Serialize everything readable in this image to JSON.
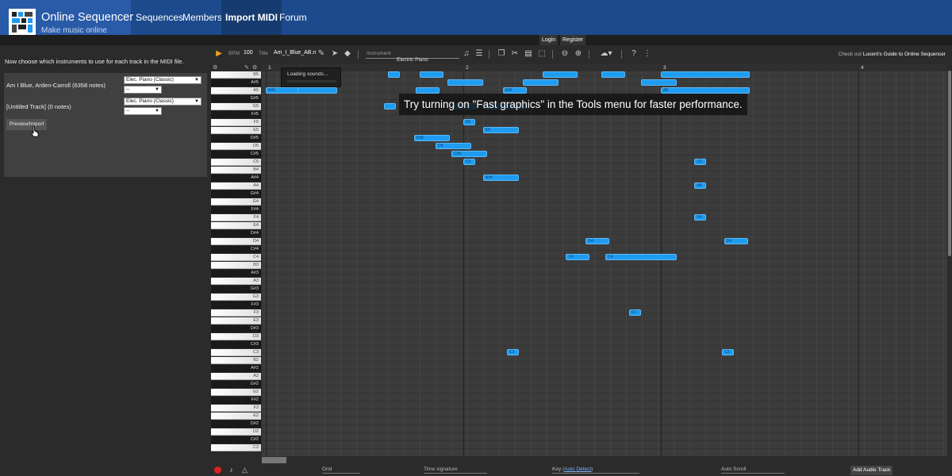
{
  "brand": {
    "title": "Online Sequencer",
    "subtitle": "Make music online"
  },
  "nav": {
    "items": [
      "Sequences",
      "Members",
      "Import MIDI",
      "Forum"
    ],
    "active": "Import MIDI"
  },
  "auth": {
    "login": "Login",
    "register": "Register"
  },
  "import": {
    "message": "Now choose which instruments to use for each track in the MIDI file.",
    "tracks": [
      {
        "name": "Am I Blue, Arden-Carroll (6358 notes)",
        "instrument": "Elec. Piano (Classic)",
        "option": "--"
      },
      {
        "name": "[Untitled Track] (0 notes)",
        "instrument": "Elec. Piano (Classic)",
        "option": "--"
      }
    ],
    "preview_button": "Preview/Import"
  },
  "toolbar": {
    "bpm_label": "BPM",
    "bpm_value": "100",
    "title_label": "Title",
    "title_value": "Am_I_Blue_AB.n",
    "instrument_label": "Instrument",
    "instrument_value": "Electric Piano",
    "guide_prefix": "Check out",
    "guide_link": "Lucent's Guide to Online Sequencer"
  },
  "ruler": {
    "bars": [
      "1",
      "2",
      "3",
      "4"
    ]
  },
  "piano_keys": [
    {
      "label": "B5",
      "black": false
    },
    {
      "label": "A#5",
      "black": true
    },
    {
      "label": "A5",
      "black": false
    },
    {
      "label": "G#5",
      "black": true
    },
    {
      "label": "G5",
      "black": false
    },
    {
      "label": "F#5",
      "black": true
    },
    {
      "label": "F5",
      "black": false
    },
    {
      "label": "E5",
      "black": false
    },
    {
      "label": "D#5",
      "black": true
    },
    {
      "label": "D5",
      "black": false
    },
    {
      "label": "C#5",
      "black": true
    },
    {
      "label": "C5",
      "black": false
    },
    {
      "label": "B4",
      "black": false
    },
    {
      "label": "A#4",
      "black": true
    },
    {
      "label": "A4",
      "black": false
    },
    {
      "label": "G#4",
      "black": true
    },
    {
      "label": "G4",
      "black": false
    },
    {
      "label": "F#4",
      "black": true
    },
    {
      "label": "F4",
      "black": false
    },
    {
      "label": "E4",
      "black": false
    },
    {
      "label": "D#4",
      "black": true
    },
    {
      "label": "D4",
      "black": false
    },
    {
      "label": "C#4",
      "black": true
    },
    {
      "label": "C4",
      "black": false
    },
    {
      "label": "B3",
      "black": false
    },
    {
      "label": "A#3",
      "black": true
    },
    {
      "label": "A3",
      "black": false
    },
    {
      "label": "G#3",
      "black": true
    },
    {
      "label": "G3",
      "black": false
    },
    {
      "label": "F#3",
      "black": true
    },
    {
      "label": "F3",
      "black": false
    },
    {
      "label": "E3",
      "black": false
    },
    {
      "label": "D#3",
      "black": true
    },
    {
      "label": "D3",
      "black": false
    },
    {
      "label": "C#3",
      "black": true
    },
    {
      "label": "C3",
      "black": false
    },
    {
      "label": "B2",
      "black": false
    },
    {
      "label": "A#2",
      "black": true
    },
    {
      "label": "A2",
      "black": false
    },
    {
      "label": "G#2",
      "black": true
    },
    {
      "label": "G2",
      "black": false
    },
    {
      "label": "F#2",
      "black": true
    },
    {
      "label": "F2",
      "black": false
    },
    {
      "label": "E2",
      "black": false
    },
    {
      "label": "D#2",
      "black": true
    },
    {
      "label": "D2",
      "black": false
    },
    {
      "label": "C#2",
      "black": true
    },
    {
      "label": "C2",
      "black": false
    }
  ],
  "notes": [
    {
      "pitch": "B5",
      "start": 1.62,
      "length": 0.06,
      "label": ""
    },
    {
      "pitch": "B5",
      "start": 1.78,
      "length": 0.12,
      "label": ""
    },
    {
      "pitch": "B5",
      "start": 2.4,
      "length": 0.18,
      "label": ""
    },
    {
      "pitch": "B5",
      "start": 2.7,
      "length": 0.12,
      "label": ""
    },
    {
      "pitch": "A#5",
      "start": 1.92,
      "length": 0.18,
      "label": ""
    },
    {
      "pitch": "A#5",
      "start": 2.3,
      "length": 0.18,
      "label": ""
    },
    {
      "pitch": "B5",
      "start": 3.0,
      "length": 0.45,
      "label": ""
    },
    {
      "pitch": "A#5",
      "start": 2.9,
      "length": 0.18,
      "label": ""
    },
    {
      "pitch": "A5",
      "start": 1.0,
      "length": 0.22,
      "label": "A#5"
    },
    {
      "pitch": "A5",
      "start": 2.2,
      "length": 0.12,
      "label": "A#5"
    },
    {
      "pitch": "A5",
      "start": 1.16,
      "length": 0.2,
      "label": ""
    },
    {
      "pitch": "A5",
      "start": 1.76,
      "length": 0.12,
      "label": ""
    },
    {
      "pitch": "A5",
      "start": 3.0,
      "length": 0.45,
      "label": "A5"
    },
    {
      "pitch": "G5",
      "start": 1.6,
      "length": 0.06,
      "label": ""
    },
    {
      "pitch": "G5",
      "start": 1.95,
      "length": 0.12,
      "label": ""
    },
    {
      "pitch": "G5",
      "start": 2.1,
      "length": 0.22,
      "label": ""
    },
    {
      "pitch": "F5",
      "start": 2.0,
      "length": 0.06,
      "label": "F5"
    },
    {
      "pitch": "E5",
      "start": 2.1,
      "length": 0.18,
      "label": "E5"
    },
    {
      "pitch": "D#5",
      "start": 1.75,
      "length": 0.18,
      "label": "D#5"
    },
    {
      "pitch": "D5",
      "start": 1.86,
      "length": 0.18,
      "label": "D5"
    },
    {
      "pitch": "C#5",
      "start": 1.94,
      "length": 0.18,
      "label": "C#5"
    },
    {
      "pitch": "C5",
      "start": 2.0,
      "length": 0.06,
      "label": "C5"
    },
    {
      "pitch": "C5",
      "start": 3.17,
      "length": 0.06,
      "label": "C5"
    },
    {
      "pitch": "A#4",
      "start": 2.1,
      "length": 0.18,
      "label": "A#4"
    },
    {
      "pitch": "A4",
      "start": 3.17,
      "length": 0.06,
      "label": "A4"
    },
    {
      "pitch": "F4",
      "start": 3.17,
      "length": 0.06,
      "label": "F4"
    },
    {
      "pitch": "D4",
      "start": 2.62,
      "length": 0.12,
      "label": "D4"
    },
    {
      "pitch": "D4",
      "start": 3.32,
      "length": 0.12,
      "label": "D4"
    },
    {
      "pitch": "C4",
      "start": 2.52,
      "length": 0.12,
      "label": "C4"
    },
    {
      "pitch": "C4",
      "start": 2.72,
      "length": 0.36,
      "label": "C4"
    },
    {
      "pitch": "F3",
      "start": 2.84,
      "length": 0.06,
      "label": "F3"
    },
    {
      "pitch": "C3",
      "start": 2.22,
      "length": 0.06,
      "label": "C3"
    },
    {
      "pitch": "C3",
      "start": 3.31,
      "length": 0.06,
      "label": "C3"
    }
  ],
  "loading_text": "Loading sounds...",
  "fast_graphics_message": "Try turning on \"Fast graphics\" in the Tools menu for faster performance.",
  "bottom": {
    "grid_label": "Grid",
    "time_signature_label": "Time signature",
    "key_label": "Key",
    "key_link": "Auto Detect",
    "auto_scroll_label": "Auto Scroll",
    "add_audio_track": "Add Audio Track"
  }
}
